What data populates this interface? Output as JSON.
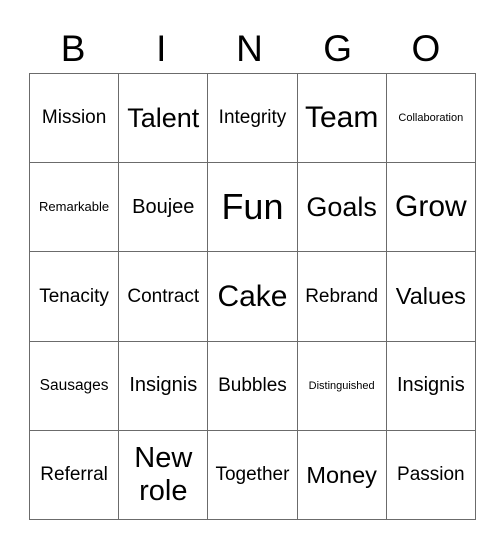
{
  "header": {
    "letters": [
      "B",
      "I",
      "N",
      "G",
      "O"
    ]
  },
  "board": {
    "rows": [
      [
        "Mission",
        "Talent",
        "Integrity",
        "Team",
        "Collaboration"
      ],
      [
        "Remarkable",
        "Boujee",
        "Fun",
        "Goals",
        "Grow"
      ],
      [
        "Tenacity",
        "Contract",
        "Cake",
        "Rebrand",
        "Values"
      ],
      [
        "Sausages",
        "Insignis",
        "Bubbles",
        "Distinguished",
        "Insignis"
      ],
      [
        "Referral",
        "New role",
        "Together",
        "Money",
        "Passion"
      ]
    ]
  },
  "colors": {
    "grid_line": "#6b6b6b",
    "text": "#000000",
    "background": "#ffffff"
  }
}
